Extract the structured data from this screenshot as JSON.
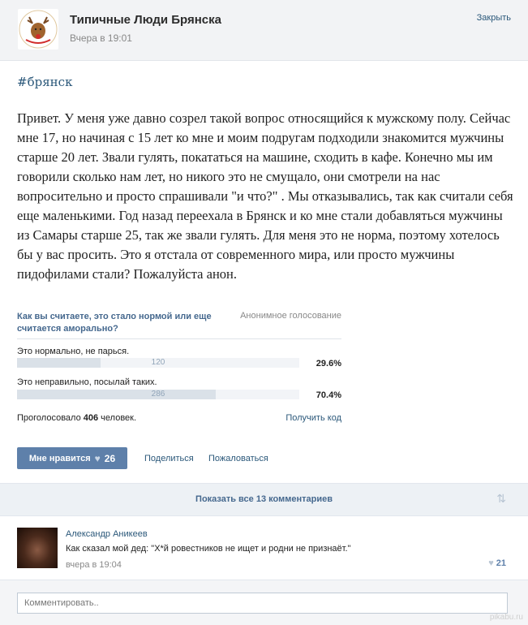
{
  "header": {
    "group_name": "Типичные Люди Брянска",
    "post_time": "Вчера в 19:01",
    "close_label": "Закрыть"
  },
  "post": {
    "hashtag": "#брянск",
    "text": "Привет. У меня уже давно созрел такой вопрос относящийся к мужскому полу. Сейчас мне 17, но начиная с 15 лет ко мне и моим подругам подходили знакомится мужчины старше 20 лет. Звали гулять, покататься на машине, сходить в кафе. Конечно мы им говорили сколько нам лет, но никого это не смущало, они смотрели на нас вопросительно и просто спрашивали \"и что?\" . Мы отказывались, так как считали себя еще маленькими. Год назад переехала в Брянск и ко мне стали добавляться мужчины из Самары старше 25, так же звали гулять. Для меня это не норма, поэтому хотелось бы у вас просить. Это я отстала от современного мира, или просто мужчины пидофилами стали? Пожалуйста анон."
  },
  "poll": {
    "question": "Как вы считаете, это стало нормой или еще считается аморально?",
    "type": "Анонимное голосование",
    "options": [
      {
        "label": "Это нормально, не парься.",
        "count": "120",
        "percent": "29.6%",
        "fraction": 0.296
      },
      {
        "label": "Это неправильно, посылай таких.",
        "count": "286",
        "percent": "70.4%",
        "fraction": 0.704
      }
    ],
    "voted_prefix": "Проголосовало",
    "voted_count": "406",
    "voted_suffix": "человек.",
    "get_code": "Получить код"
  },
  "actions": {
    "like_label": "Мне нравится",
    "like_count": "26",
    "share": "Поделиться",
    "report": "Пожаловаться"
  },
  "comments_bar": {
    "show_all": "Показать все 13 комментариев"
  },
  "comment": {
    "author": "Александр Аникеев",
    "text": "Как сказал мой дед: \"Х*й ровестников не ищет и родни не признаёт.\"",
    "time": "вчера в 19:04",
    "likes": "21"
  },
  "comment_input": {
    "placeholder": "Комментировать.."
  },
  "watermark": "pikabu.ru",
  "colors": {
    "link": "#2b587a",
    "button": "#5e80aa",
    "poll_fill": "#dae1e8"
  }
}
